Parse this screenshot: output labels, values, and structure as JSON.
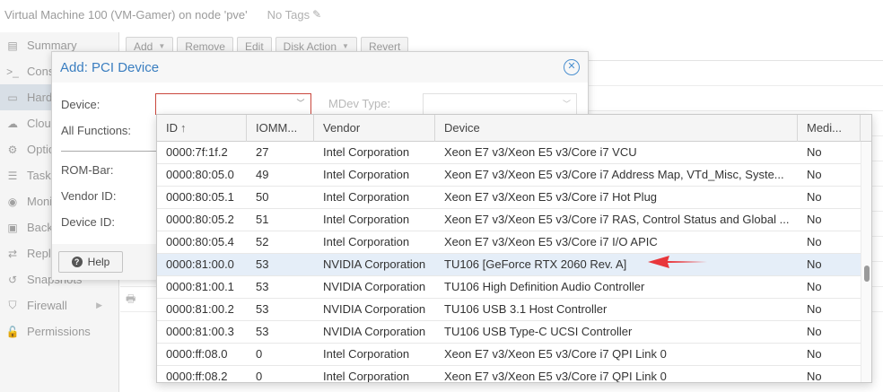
{
  "header": {
    "title": "Virtual Machine 100 (VM-Gamer) on node 'pve'",
    "tags": "No Tags"
  },
  "sidebar": {
    "items": [
      {
        "label": "Summary",
        "icon": "book-icon"
      },
      {
        "label": "Console",
        "icon": "terminal-icon"
      },
      {
        "label": "Hardware",
        "icon": "monitor-icon"
      },
      {
        "label": "Cloud-Init",
        "icon": "cloud-icon"
      },
      {
        "label": "Options",
        "icon": "gear-icon"
      },
      {
        "label": "Task History",
        "icon": "list-icon"
      },
      {
        "label": "Monitor",
        "icon": "eye-icon"
      },
      {
        "label": "Backup",
        "icon": "floppy-icon"
      },
      {
        "label": "Replication",
        "icon": "retweet-icon"
      },
      {
        "label": "Snapshots",
        "icon": "history-icon"
      },
      {
        "label": "Firewall",
        "icon": "shield-icon"
      },
      {
        "label": "Permissions",
        "icon": "unlock-icon"
      }
    ]
  },
  "toolbar": {
    "add": "Add",
    "remove": "Remove",
    "edit": "Edit",
    "disk_action": "Disk Action",
    "revert": "Revert"
  },
  "dialog": {
    "title": "Add: PCI Device",
    "device_label": "Device:",
    "device_value": "",
    "mdev_label": "MDev Type:",
    "all_functions_label": "All Functions:",
    "rombar_label": "ROM-Bar:",
    "vendor_id_label": "Vendor ID:",
    "device_id_label": "Device ID:",
    "help_label": "Help"
  },
  "grid": {
    "columns": [
      "ID",
      "IOMM...",
      "Vendor",
      "Device",
      "Medi..."
    ],
    "sort_indicator": "↑",
    "selected_row": 5,
    "rows": [
      [
        "0000:7f:1f.2",
        "27",
        "Intel Corporation",
        "Xeon E7 v3/Xeon E5 v3/Core i7 VCU",
        "No"
      ],
      [
        "0000:80:05.0",
        "49",
        "Intel Corporation",
        "Xeon E7 v3/Xeon E5 v3/Core i7 Address Map, VTd_Misc, Syste...",
        "No"
      ],
      [
        "0000:80:05.1",
        "50",
        "Intel Corporation",
        "Xeon E7 v3/Xeon E5 v3/Core i7 Hot Plug",
        "No"
      ],
      [
        "0000:80:05.2",
        "51",
        "Intel Corporation",
        "Xeon E7 v3/Xeon E5 v3/Core i7 RAS, Control Status and Global ...",
        "No"
      ],
      [
        "0000:80:05.4",
        "52",
        "Intel Corporation",
        "Xeon E7 v3/Xeon E5 v3/Core i7 I/O APIC",
        "No"
      ],
      [
        "0000:81:00.0",
        "53",
        "NVIDIA Corporation",
        "TU106 [GeForce RTX 2060 Rev. A]",
        "No"
      ],
      [
        "0000:81:00.1",
        "53",
        "NVIDIA Corporation",
        "TU106 High Definition Audio Controller",
        "No"
      ],
      [
        "0000:81:00.2",
        "53",
        "NVIDIA Corporation",
        "TU106 USB 3.1 Host Controller",
        "No"
      ],
      [
        "0000:81:00.3",
        "53",
        "NVIDIA Corporation",
        "TU106 USB Type-C UCSI Controller",
        "No"
      ],
      [
        "0000:ff:08.0",
        "0",
        "Intel Corporation",
        "Xeon E7 v3/Xeon E5 v3/Core i7 QPI Link 0",
        "No"
      ],
      [
        "0000:ff:08.2",
        "0",
        "Intel Corporation",
        "Xeon E7 v3/Xeon E5 v3/Core i7 QPI Link 0",
        "No"
      ]
    ]
  },
  "annotation": {
    "arrow_color": "#e8363b",
    "points_to_row": 5
  },
  "colors": {
    "title_blue": "#3a7ec0",
    "selected_row": "#e5eef8",
    "invalid_border": "#c9473d"
  }
}
